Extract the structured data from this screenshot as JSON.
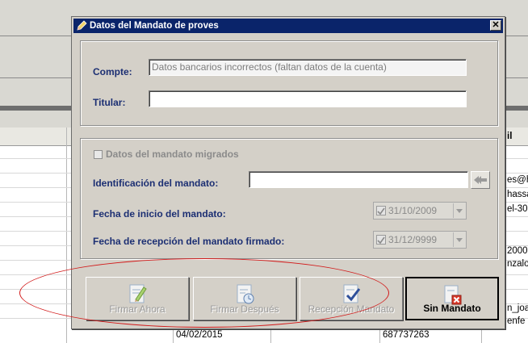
{
  "dialog": {
    "title": "Datos del Mandato de proves",
    "close_label": "✕"
  },
  "account_section": {
    "compte_label": "Compte:",
    "compte_value": "Datos bancarios incorrectos (faltan datos de la cuenta)",
    "titular_label": "Titular:",
    "titular_value": ""
  },
  "mandate_section": {
    "migrated_label": "Datos del mandato migrados",
    "id_label": "Identificación del mandato:",
    "id_value": "",
    "start_label": "Fecha de inicio del mandato:",
    "start_value": "31/10/2009",
    "received_label": "Fecha de recepción del mandato firmado:",
    "received_value": "31/12/9999"
  },
  "actions": {
    "sign_now": "Firmar Ahora",
    "sign_later": "Firmar Después",
    "reception": "Recepción Mandato",
    "no_mandate": "Sin Mandato"
  },
  "background": {
    "header_right": "il",
    "cells": [
      "es@h",
      "hassa",
      "el-30",
      "2000",
      "nzalo",
      "n_joa",
      "enfe",
      "04/02/2015",
      "687737263"
    ]
  }
}
